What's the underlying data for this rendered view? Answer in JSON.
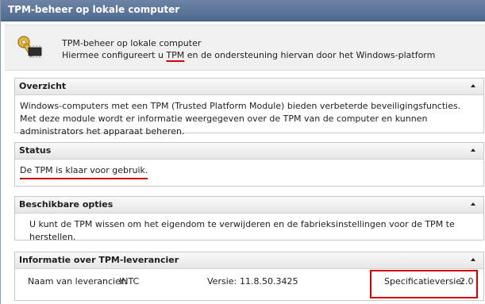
{
  "window": {
    "title": "TPM-beheer op lokale computer"
  },
  "header": {
    "title": "TPM-beheer op lokale computer",
    "subtitle_pre": "Hiermee configureert u ",
    "subtitle_link": "TPM",
    "subtitle_post": " en de ondersteuning hiervan door het Windows-platform",
    "icon": "key-chip-icon"
  },
  "sections": {
    "overview": {
      "title": "Overzicht",
      "text": "Windows-computers met een TPM (Trusted Platform Module) bieden verbeterde beveiligingsfuncties. Met deze module wordt er informatie weergegeven over de TPM van de computer en kunnen administrators het apparaat beheren."
    },
    "status": {
      "title": "Status",
      "text": "De TPM is klaar voor gebruik."
    },
    "options": {
      "title": "Beschikbare opties",
      "text": "U kunt de TPM wissen om het eigendom te verwijderen en de fabrieksinstellingen voor de TPM te herstellen."
    },
    "vendor": {
      "title": "Informatie over TPM-leverancier",
      "vendor_label": "Naam van leverancier:",
      "vendor_value": "INTC",
      "version_label": "Versie:",
      "version_value": "11.8.50.3425",
      "spec_label": "Specificatieversie:",
      "spec_value": "2.0"
    }
  },
  "colors": {
    "titlebar": "#5a7399",
    "highlight": "#d40000"
  }
}
